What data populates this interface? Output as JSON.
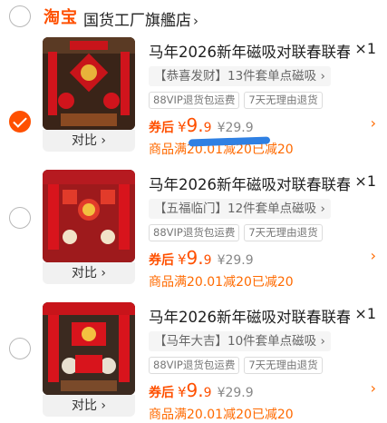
{
  "shop": {
    "logo": "淘宝",
    "name": "国货工厂旗艦店",
    "chevron": "›"
  },
  "items": [
    {
      "checked": true,
      "title": "马年2026新年磁吸对联春联春",
      "qty": "×1",
      "sku": "【恭喜发财】13件套单点磁吸 ›",
      "tags": [
        "88VIP退货包运费",
        "7天无理由退货"
      ],
      "price_label": "券后",
      "price_currency": "¥",
      "price_int": "9.",
      "price_dec": "9",
      "orig_price": "¥29.9",
      "promo": "商品满20.01减20已减20",
      "compare": "对比 ›",
      "chevron": "›"
    },
    {
      "checked": false,
      "title": "马年2026新年磁吸对联春联春",
      "qty": "×1",
      "sku": "【五福临门】12件套单点磁吸 ›",
      "tags": [
        "88VIP退货包运费",
        "7天无理由退货"
      ],
      "price_label": "券后",
      "price_currency": "¥",
      "price_int": "9.",
      "price_dec": "9",
      "orig_price": "¥29.9",
      "promo": "商品满20.01减20已减20",
      "compare": "对比 ›",
      "chevron": "›"
    },
    {
      "checked": false,
      "title": "马年2026新年磁吸对联春联春",
      "qty": "×1",
      "sku": "【马年大吉】10件套单点磁吸 ›",
      "tags": [
        "88VIP退货包运费",
        "7天无理由退货"
      ],
      "price_label": "券后",
      "price_currency": "¥",
      "price_int": "9.",
      "price_dec": "9",
      "orig_price": "¥29.9",
      "promo": "商品满20.01减20已减20",
      "compare": "对比 ›",
      "chevron": "›"
    }
  ],
  "colors": {
    "accent": "#ff5000",
    "promo": "#ff6a00",
    "scribble": "#2f80e3"
  }
}
